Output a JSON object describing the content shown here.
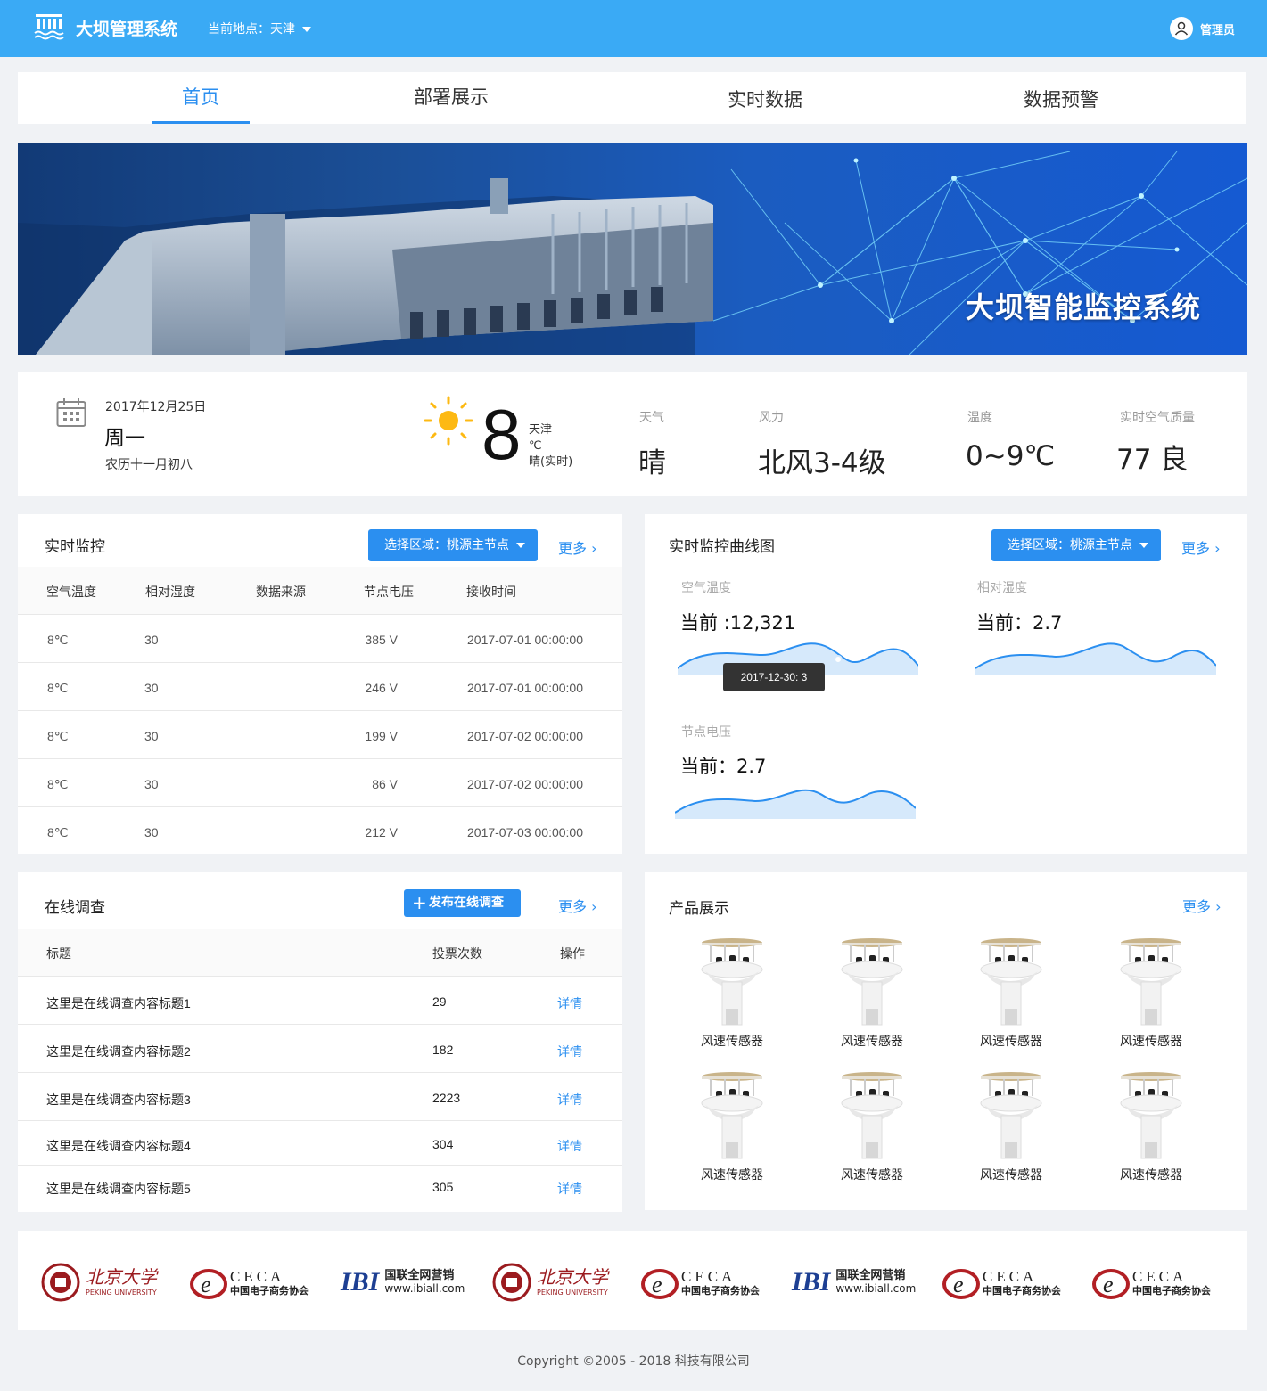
{
  "header": {
    "app_title": "大坝管理系统",
    "location": "当前地点：天津",
    "user": "管理员"
  },
  "nav": {
    "tabs": [
      {
        "label": "首页",
        "active": true
      },
      {
        "label": "部署展示"
      },
      {
        "label": "实时数据"
      },
      {
        "label": "数据预警"
      }
    ]
  },
  "banner": {
    "title": "大坝智能监控系统"
  },
  "info": {
    "date": "2017年12月25日",
    "weekday": "周一",
    "lunar": "农历十一月初八",
    "temperature": "8",
    "city": "天津",
    "unit": "℃",
    "condition": "晴(实时)",
    "weather_label": "天气",
    "weather_value": "晴",
    "wind_label": "风力",
    "wind_value": "北风3-4级",
    "temp_label": "温度",
    "temp_value": "0~9℃",
    "aqi_label": "实时空气质量",
    "aqi_value": "77 良"
  },
  "monitor": {
    "title": "实时监控",
    "select": "选择区域：桃源主节点",
    "more": "更多",
    "columns": [
      "空气温度",
      "相对湿度",
      "数据来源",
      "节点电压",
      "接收时间"
    ],
    "rows": [
      {
        "temp": "8℃",
        "humidity": "30",
        "source": "",
        "voltage": "385 V",
        "time": "2017-07-01 00:00:00"
      },
      {
        "temp": "8℃",
        "humidity": "30",
        "source": "",
        "voltage": "246 V",
        "time": "2017-07-01 00:00:00"
      },
      {
        "temp": "8℃",
        "humidity": "30",
        "source": "",
        "voltage": "199 V",
        "time": "2017-07-02 00:00:00"
      },
      {
        "temp": "8℃",
        "humidity": "30",
        "source": "",
        "voltage": "86 V",
        "time": "2017-07-02 00:00:00"
      },
      {
        "temp": "8℃",
        "humidity": "30",
        "source": "",
        "voltage": "212 V",
        "time": "2017-07-03 00:00:00"
      }
    ]
  },
  "curves": {
    "title": "实时监控曲线图",
    "select": "选择区域：桃源主节点",
    "more": "更多",
    "air_temp_label": "空气温度",
    "air_temp_current": "当前 :12,321",
    "humidity_label": "相对湿度",
    "humidity_current": "当前：2.7",
    "voltage_label": "节点电压",
    "voltage_current": "当前：2.7",
    "tooltip": "2017-12-30:  3"
  },
  "survey": {
    "title": "在线调查",
    "publish": "发布在线调查",
    "more": "更多",
    "columns": [
      "标题",
      "投票次数",
      "操作"
    ],
    "rows": [
      {
        "title": "这里是在线调查内容标题1",
        "votes": "29",
        "action": "详情"
      },
      {
        "title": "这里是在线调查内容标题2",
        "votes": "182",
        "action": "详情"
      },
      {
        "title": "这里是在线调查内容标题3",
        "votes": "2223",
        "action": "详情"
      },
      {
        "title": "这里是在线调查内容标题4",
        "votes": "304",
        "action": "详情"
      },
      {
        "title": "这里是在线调查内容标题5",
        "votes": "305",
        "action": "详情"
      }
    ]
  },
  "products": {
    "title": "产品展示",
    "more": "更多",
    "items": [
      "风速传感器",
      "风速传感器",
      "风速传感器",
      "风速传感器",
      "风速传感器",
      "风速传感器",
      "风速传感器",
      "风速传感器"
    ]
  },
  "partners": [
    {
      "type": "pku",
      "cn": "北京大学",
      "en": "PEKING UNIVERSITY"
    },
    {
      "type": "ceca",
      "en": "CECA",
      "cn": "中国电子商务协会"
    },
    {
      "type": "ibi",
      "cn": "国联全网营销",
      "en": "www.ibiall.com"
    },
    {
      "type": "pku",
      "cn": "北京大学",
      "en": "PEKING UNIVERSITY"
    },
    {
      "type": "ceca",
      "en": "CECA",
      "cn": "中国电子商务协会"
    },
    {
      "type": "ibi",
      "cn": "国联全网营销",
      "en": "www.ibiall.com"
    },
    {
      "type": "ceca",
      "en": "CECA",
      "cn": "中国电子商务协会"
    },
    {
      "type": "ceca",
      "en": "CECA",
      "cn": "中国电子商务协会"
    }
  ],
  "footer": {
    "copyright": "Copyright ©2005 - 2018  科技有限公司"
  },
  "colors": {
    "primary": "#2b8ff0",
    "header": "#3aaaf5"
  }
}
